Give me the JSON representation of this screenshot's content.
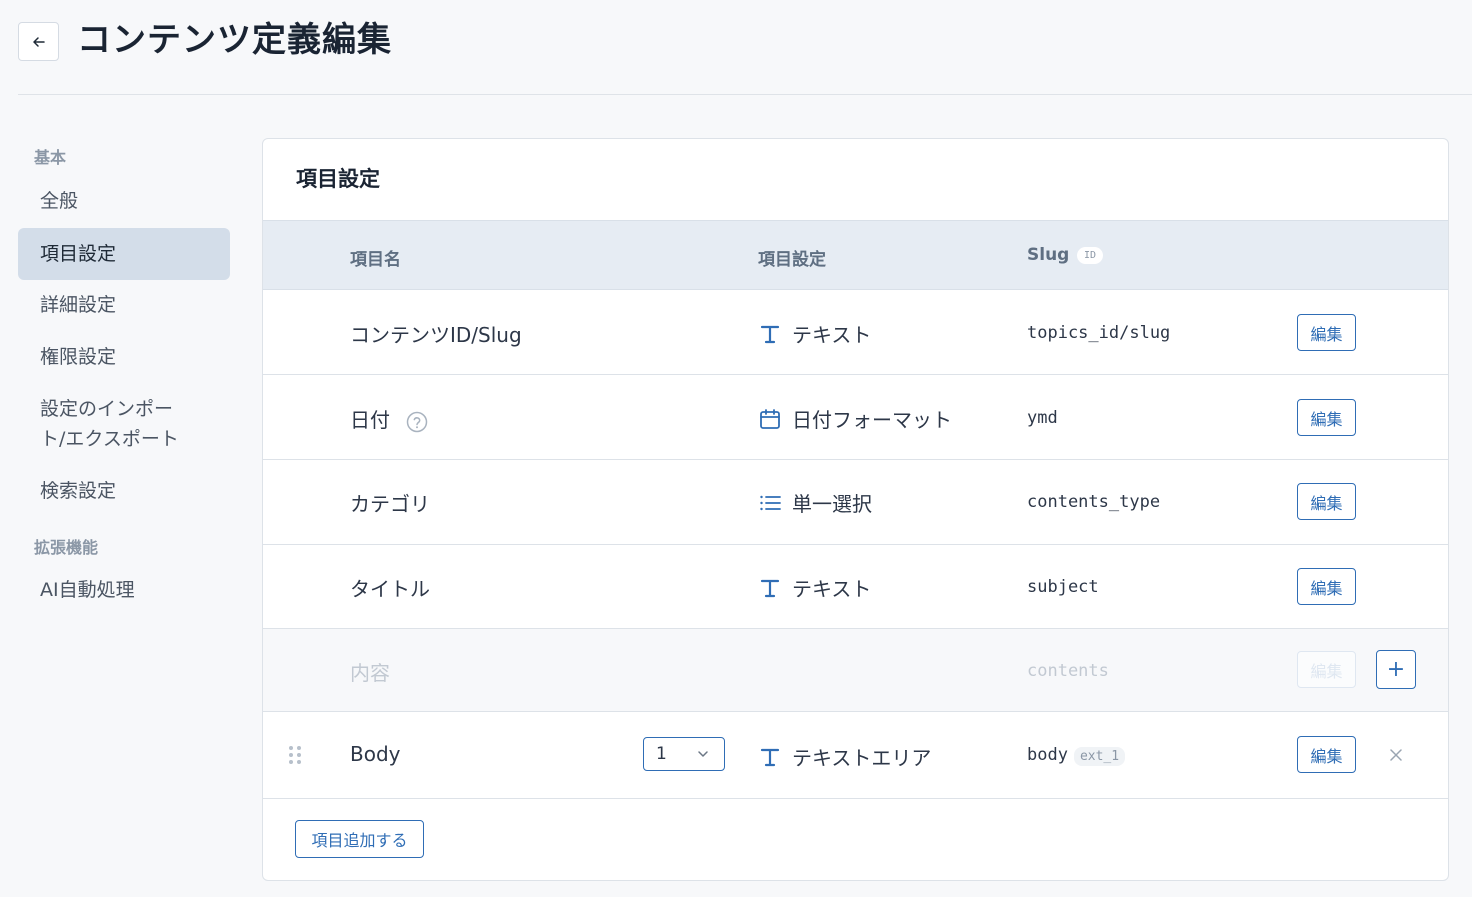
{
  "header": {
    "title": "コンテンツ定義編集"
  },
  "sidebar": {
    "sections": [
      {
        "heading": "基本",
        "items": [
          "全般",
          "項目設定",
          "詳細設定",
          "権限設定",
          "設定のインポート/エクスポート",
          "検索設定"
        ]
      },
      {
        "heading": "拡張機能",
        "items": [
          "AI自動処理"
        ]
      }
    ],
    "active_item": "項目設定",
    "import_line1": "設定のインポー",
    "import_line2": "ト/エクスポート"
  },
  "card": {
    "title": "項目設定",
    "columns": {
      "name": "項目名",
      "setting": "項目設定",
      "slug": "Slug",
      "slug_badge": "ID"
    },
    "rows": [
      {
        "name": "コンテンツID/Slug",
        "type_icon": "text-type-icon",
        "type": "テキスト",
        "slug": "topics_id/slug",
        "edit": "編集"
      },
      {
        "name": "日付",
        "help_icon": "help-circle-icon",
        "type_icon": "calendar-icon",
        "type": "日付フォーマット",
        "slug": "ymd",
        "edit": "編集"
      },
      {
        "name": "カテゴリ",
        "type_icon": "list-icon",
        "type": "単一選択",
        "slug": "contents_type",
        "edit": "編集"
      },
      {
        "name": "タイトル",
        "type_icon": "text-type-icon",
        "type": "テキスト",
        "slug": "subject",
        "edit": "編集"
      },
      {
        "name": "内容",
        "slug": "contents",
        "edit": "編集",
        "disabled": true,
        "plus": "+"
      },
      {
        "name": "Body",
        "select_value": "1",
        "type_icon": "text-type-icon",
        "type": "テキストエリア",
        "slug": "body",
        "slug_badge": "ext_1",
        "edit": "編集"
      }
    ],
    "add_button": "項目追加する"
  },
  "colors": {
    "accent": "#2f6db5",
    "active_bg": "#d3dde9",
    "header_bg": "#e6ecf3"
  }
}
